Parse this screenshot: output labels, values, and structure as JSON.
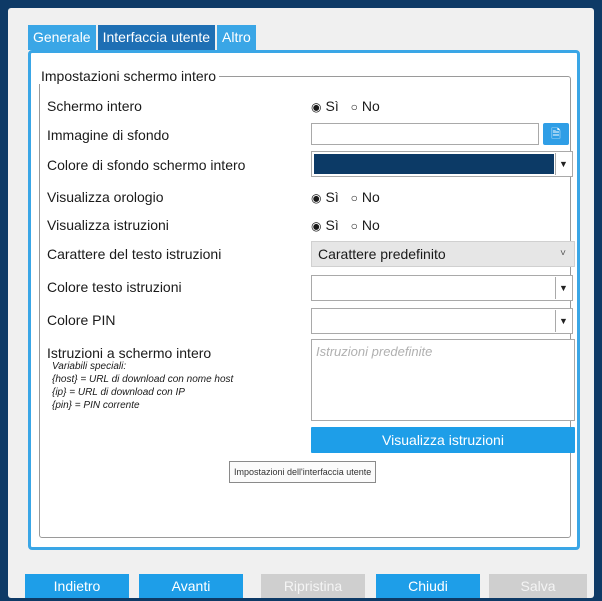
{
  "tabs": [
    {
      "label": "Generale"
    },
    {
      "label": "Interfaccia utente"
    },
    {
      "label": "Altro"
    }
  ],
  "group": {
    "title": "Impostazioni schermo intero"
  },
  "fields": {
    "fullscreen": {
      "label": "Schermo intero",
      "yes": "Sì",
      "no": "No",
      "selected": "Sì"
    },
    "background_image": {
      "label": "Immagine di sfondo",
      "value": ""
    },
    "background_color": {
      "label": "Colore di sfondo schermo intero",
      "color": "#0c3a66"
    },
    "show_clock": {
      "label": "Visualizza orologio",
      "yes": "Sì",
      "no": "No",
      "selected": "Sì"
    },
    "show_instructions": {
      "label": "Visualizza istruzioni",
      "yes": "Sì",
      "no": "No",
      "selected": "Sì"
    },
    "instructions_font": {
      "label": "Carattere del testo istruzioni",
      "value": "Carattere predefinito"
    },
    "instructions_text_color": {
      "label": "Colore testo istruzioni",
      "color": "#ffffff"
    },
    "pin_color": {
      "label": "Colore PIN",
      "color": "#ffffff"
    },
    "fullscreen_instructions": {
      "label": "Istruzioni a schermo intero",
      "placeholder": "Istruzioni predefinite",
      "notes": [
        "Variabili speciali:",
        "{host} = URL di download con nome host",
        "{ip} = URL di download con IP",
        "{pin} = PIN corrente"
      ]
    }
  },
  "show_instructions_button": "Visualizza istruzioni",
  "tooltip": "Impostazioni dell'interfaccia utente",
  "buttons": {
    "back": "Indietro",
    "next": "Avanti",
    "reset": "Ripristina",
    "close": "Chiudi",
    "save": "Salva"
  },
  "colors": {
    "accent": "#1e9ee8",
    "active_tab": "#1e6fb4",
    "window_bg": "#0e3a66"
  },
  "icons": {
    "browse": "file-browse-icon",
    "dropdown": "chevron-down-icon",
    "radio": "radio-icon"
  }
}
